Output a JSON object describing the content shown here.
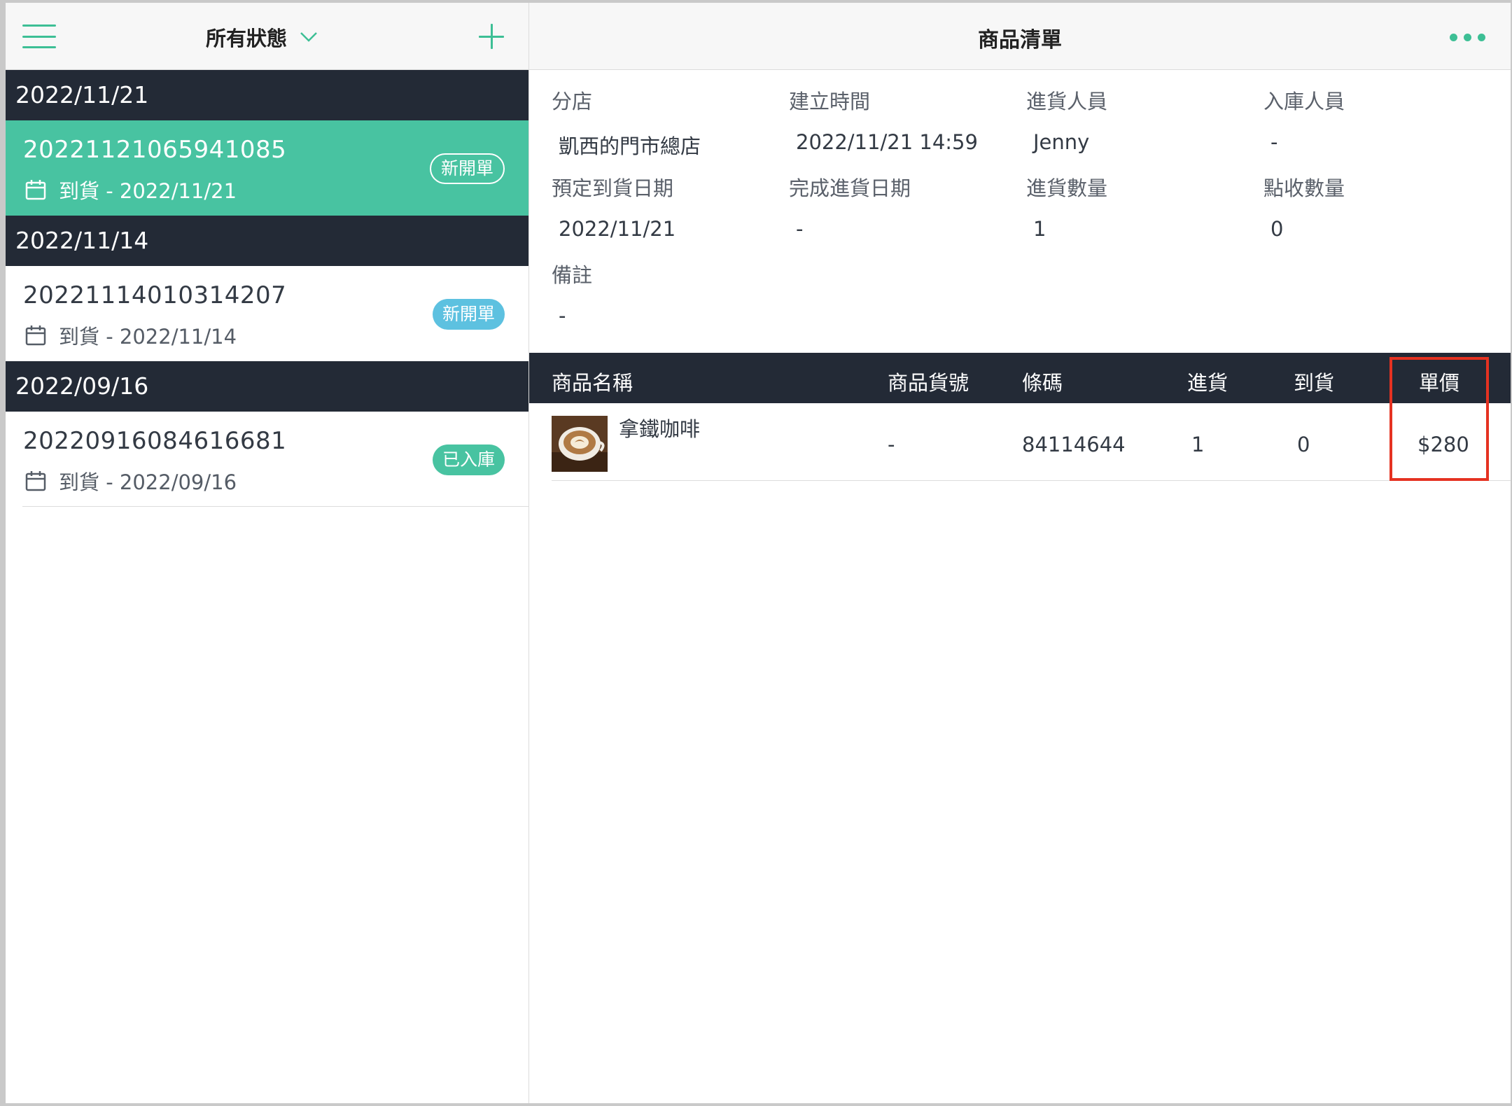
{
  "left_header": {
    "filter_label": "所有狀態"
  },
  "groups": [
    {
      "date": "2022/11/21",
      "orders": [
        {
          "number": "20221121065941085",
          "arrival": "到貨 - 2022/11/21",
          "badge": "新開單"
        }
      ]
    },
    {
      "date": "2022/11/14",
      "orders": [
        {
          "number": "20221114010314207",
          "arrival": "到貨 - 2022/11/14",
          "badge": "新開單"
        }
      ]
    },
    {
      "date": "2022/09/16",
      "orders": [
        {
          "number": "20220916084616681",
          "arrival": "到貨 - 2022/09/16",
          "badge": "已入庫"
        }
      ]
    }
  ],
  "detail": {
    "title": "商品清單",
    "fields": {
      "branch": {
        "label": "分店",
        "value": "凱西的門市總店"
      },
      "created": {
        "label": "建立時間",
        "value": "2022/11/21 14:59"
      },
      "purchaser": {
        "label": "進貨人員",
        "value": "Jenny"
      },
      "stocker": {
        "label": "入庫人員",
        "value": "-"
      },
      "expected": {
        "label": "預定到貨日期",
        "value": "2022/11/21"
      },
      "completed": {
        "label": "完成進貨日期",
        "value": "-"
      },
      "qty_in": {
        "label": "進貨數量",
        "value": "1"
      },
      "qty_checked": {
        "label": "點收數量",
        "value": "0"
      },
      "note": {
        "label": "備註",
        "value": "-"
      }
    },
    "table": {
      "headers": {
        "name": "商品名稱",
        "sku": "商品貨號",
        "barcode": "條碼",
        "purchase": "進貨",
        "arrival": "到貨",
        "price": "單價"
      },
      "rows": [
        {
          "name": "拿鐵咖啡",
          "sku": "-",
          "barcode": "84114644",
          "purchase": "1",
          "arrival": "0",
          "price": "$280"
        }
      ]
    }
  },
  "colors": {
    "accent": "#3dbf95",
    "selected_row": "#48c3a1",
    "dark_header": "#232a36",
    "badge_blue": "#5dc1e0",
    "highlight": "#e53221"
  }
}
